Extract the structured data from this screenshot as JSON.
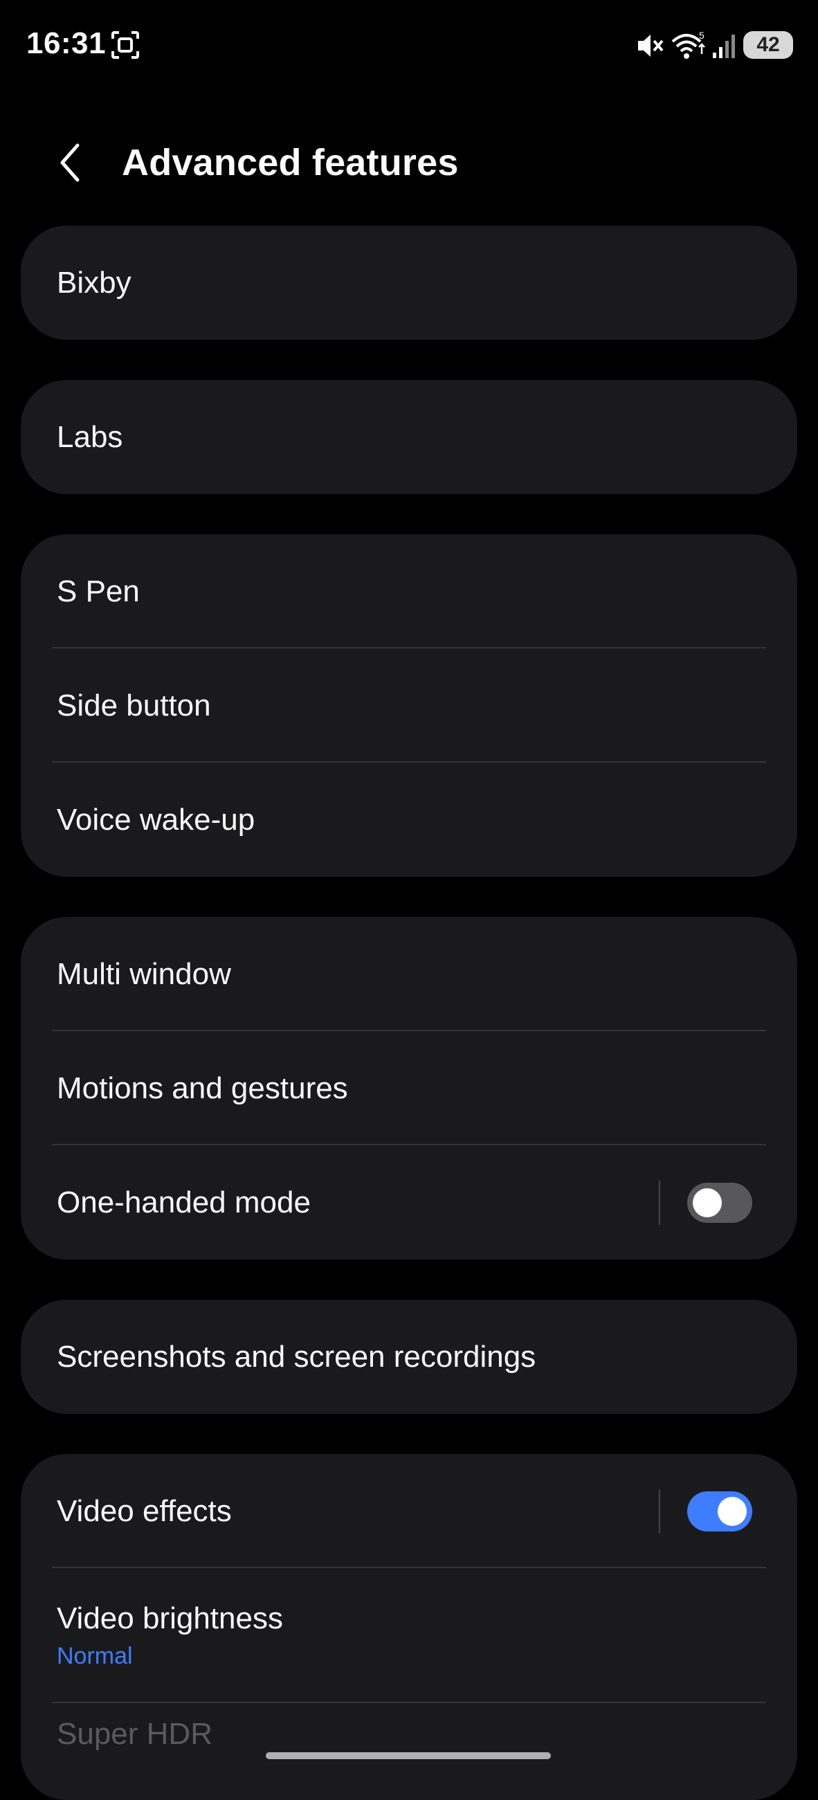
{
  "status_bar": {
    "time": "16:31",
    "battery": "42",
    "icons": [
      "screenshot-icon",
      "mute-icon",
      "wifi-icon",
      "signal-icon",
      "battery-icon"
    ]
  },
  "header": {
    "title": "Advanced features",
    "back_icon": "chevron-left-icon"
  },
  "groups": [
    {
      "items": [
        {
          "label": "Bixby"
        }
      ]
    },
    {
      "items": [
        {
          "label": "Labs"
        }
      ]
    },
    {
      "items": [
        {
          "label": "S Pen"
        },
        {
          "label": "Side button"
        },
        {
          "label": "Voice wake-up"
        }
      ]
    },
    {
      "items": [
        {
          "label": "Multi window"
        },
        {
          "label": "Motions and gestures"
        },
        {
          "label": "One-handed mode",
          "toggle": false
        }
      ]
    },
    {
      "items": [
        {
          "label": "Screenshots and screen recordings"
        }
      ]
    },
    {
      "items": [
        {
          "label": "Video effects",
          "toggle": true
        },
        {
          "label": "Video brightness",
          "sublabel": "Normal"
        },
        {
          "label": "Super HDR"
        }
      ]
    }
  ],
  "colors": {
    "accent": "#3e7dff",
    "card": "#1a1a1c",
    "background": "#000000"
  }
}
